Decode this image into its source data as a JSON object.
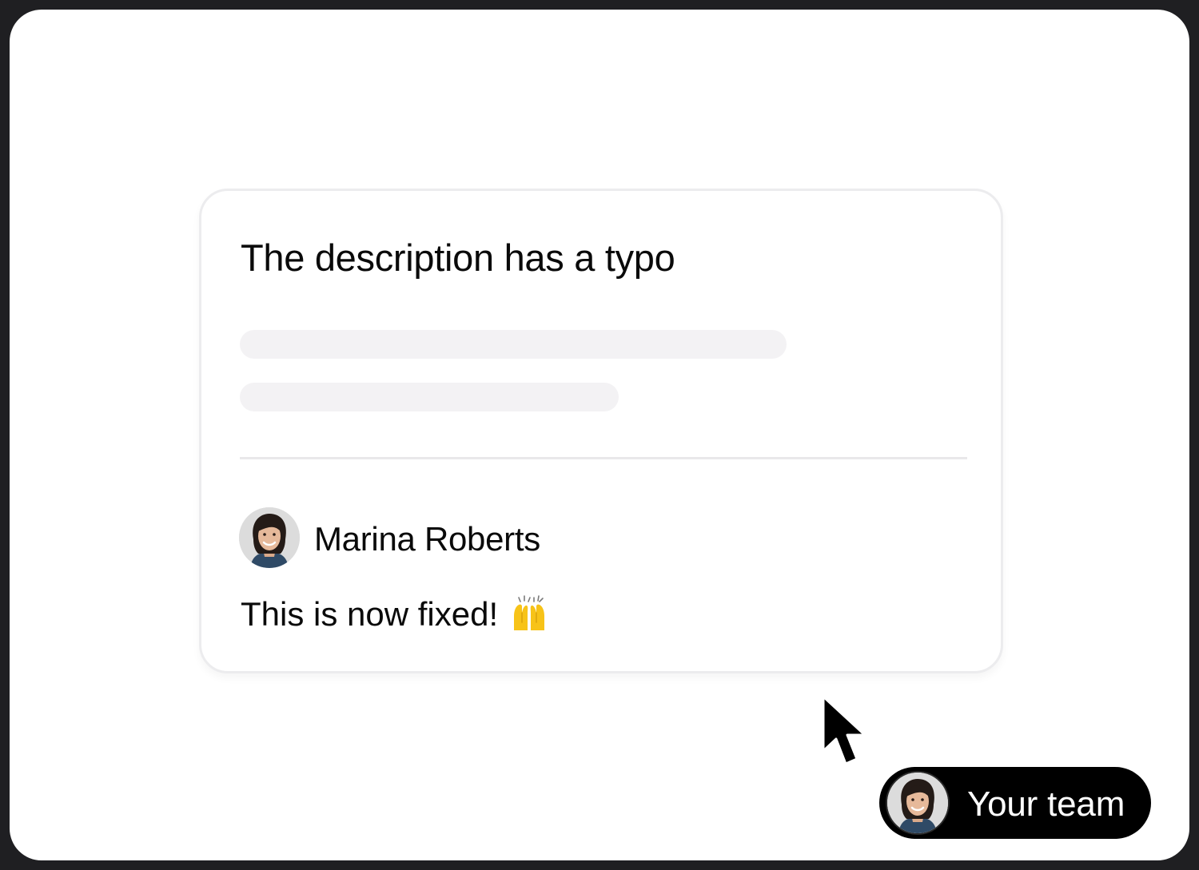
{
  "card": {
    "title": "The description has a typo",
    "comment": {
      "author": "Marina Roberts",
      "author_avatar": "avatar-photo",
      "text": "This is now fixed!",
      "emoji_icon": "raising-hands-emoji"
    }
  },
  "cursor_icon": "pointer-arrow-icon",
  "presence_pill": {
    "label": "Your team",
    "avatar": "avatar-photo"
  },
  "colors": {
    "frame": "#1f1f22",
    "screen": "#ffffff",
    "card_border": "#ececee",
    "skeleton": "#f3f2f4",
    "text": "#0a0a0a",
    "pill": "#000000",
    "emoji": "#f7c318"
  }
}
